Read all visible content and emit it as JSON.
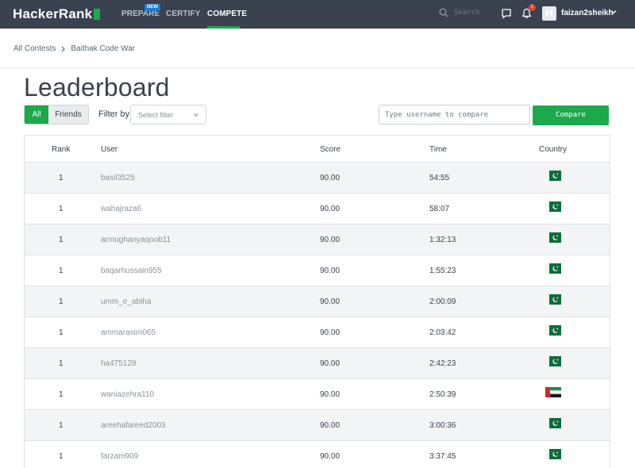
{
  "nav": {
    "logo_text": "HackerRank",
    "items": [
      {
        "label": "PREPARE",
        "badge": "NEW"
      },
      {
        "label": "CERTIFY"
      },
      {
        "label": "COMPETE",
        "active": true
      }
    ],
    "search_placeholder": "Search",
    "notification_count": "1",
    "avatar_letter": "H",
    "username": "faizan2sheikh"
  },
  "breadcrumb": {
    "items": [
      "All Contests",
      "Baithak Code War"
    ]
  },
  "page": {
    "title": "Leaderboard"
  },
  "filters": {
    "tab_all": "All",
    "tab_friends": "Friends",
    "filter_label": "Filter by",
    "filter_placeholder": "Select filter",
    "compare_placeholder": "Type username to compare",
    "compare_button": "Compare"
  },
  "table": {
    "headers": {
      "rank": "Rank",
      "user": "User",
      "score": "Score",
      "time": "Time",
      "country": "Country"
    },
    "rows": [
      {
        "rank": "1",
        "user": "basil3525",
        "score": "90.00",
        "time": "54:55",
        "flag": "pakistan-flag"
      },
      {
        "rank": "1",
        "user": "wahajraza6",
        "score": "90.00",
        "time": "58:07",
        "flag": "pakistan-flag"
      },
      {
        "rank": "1",
        "user": "armughanyaqoob11",
        "score": "90.00",
        "time": "1:32:13",
        "flag": "pakistan-flag"
      },
      {
        "rank": "1",
        "user": "baqarhussain955",
        "score": "90.00",
        "time": "1:55:23",
        "flag": "pakistan-flag"
      },
      {
        "rank": "1",
        "user": "umm_e_abiha",
        "score": "90.00",
        "time": "2:00:09",
        "flag": "pakistan-flag"
      },
      {
        "rank": "1",
        "user": "ammarasim065",
        "score": "90.00",
        "time": "2:03:42",
        "flag": "pakistan-flag"
      },
      {
        "rank": "1",
        "user": "ha475128",
        "score": "90.00",
        "time": "2:42:23",
        "flag": "pakistan-flag"
      },
      {
        "rank": "1",
        "user": "waniazehra110",
        "score": "90.00",
        "time": "2:50:39",
        "flag": "uae-flag"
      },
      {
        "rank": "1",
        "user": "areehafareed2003",
        "score": "90.00",
        "time": "3:00:36",
        "flag": "pakistan-flag"
      },
      {
        "rank": "1",
        "user": "farzam909",
        "score": "90.00",
        "time": "3:37:45",
        "flag": "pakistan-flag"
      }
    ]
  },
  "colors": {
    "nav_bg": "#39424e",
    "brand_green": "#1ba94c",
    "badge_blue": "#1c7bd6",
    "notification_red": "#e0422e"
  }
}
